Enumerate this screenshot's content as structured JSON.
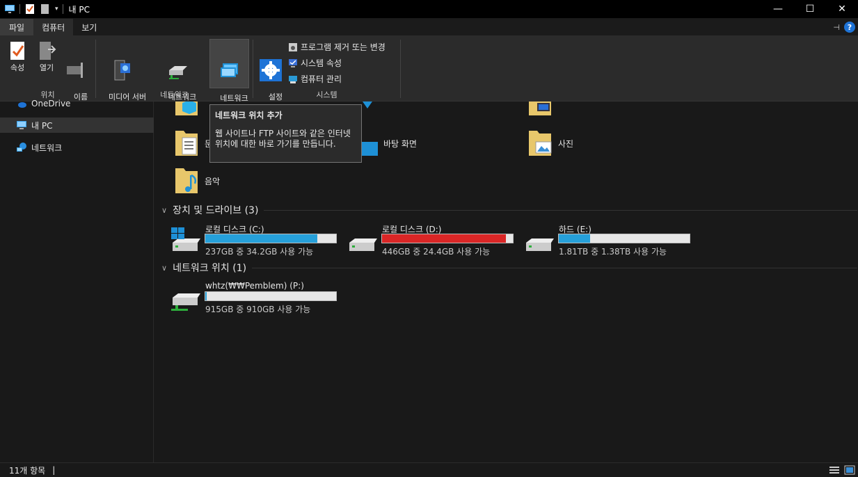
{
  "window": {
    "title": "내 PC",
    "controls": {
      "minimize": "—",
      "maximize": "☐",
      "close": "✕"
    }
  },
  "tabs": [
    {
      "label": "파일"
    },
    {
      "label": "컴퓨터"
    },
    {
      "label": "보기"
    }
  ],
  "help_glyph": "?",
  "ribbon": {
    "location_group": {
      "label": "위치",
      "properties": "속성",
      "open": "열기",
      "rename": "이름\n바꾸기"
    },
    "network_group": {
      "label": "네트워크",
      "media_server": "미디어 서버\n연결",
      "map_drive": "네트워크\n드라이브 연결",
      "add_location": "네트워크\n위치 추가"
    },
    "system_group": {
      "label": "시스템",
      "open_settings": "설정\n열기",
      "uninstall": "프로그램 제거 또는 변경",
      "system_props": "시스템 속성",
      "manage": "컴퓨터 관리"
    }
  },
  "sidebar": {
    "items": [
      {
        "label": "OneDrive",
        "icon": "onedrive-icon"
      },
      {
        "label": "내 PC",
        "icon": "pc-icon"
      },
      {
        "label": "네트워크",
        "icon": "network-icon"
      }
    ]
  },
  "folders": [
    {
      "label": "",
      "icon": "3d-objects-folder-icon"
    },
    {
      "label": "",
      "icon": "downloads-folder-icon"
    },
    {
      "label": "",
      "icon": "videos-folder-icon"
    },
    {
      "label": "문서",
      "icon": "documents-folder-icon"
    },
    {
      "label": "바탕 화면",
      "icon": "desktop-folder-icon"
    },
    {
      "label": "사진",
      "icon": "pictures-folder-icon"
    },
    {
      "label": "음악",
      "icon": "music-folder-icon"
    }
  ],
  "sections": {
    "devices": "장치 및 드라이브 (3)",
    "network": "네트워크 위치 (1)"
  },
  "drives": [
    {
      "name": "로컬 디스크 (C:)",
      "info": "237GB 중 34.2GB 사용 가능",
      "used_fraction": 0.856,
      "color": "#26a0da"
    },
    {
      "name": "로컬 디스크 (D:)",
      "info": "446GB 중 24.4GB 사용 가능",
      "used_fraction": 0.945,
      "color": "#da2626"
    },
    {
      "name": "하드 (E:)",
      "info": "1.81TB 중 1.38TB 사용 가능",
      "used_fraction": 0.238,
      "color": "#26a0da"
    }
  ],
  "network_locations": [
    {
      "name": "whtz(₩₩Pemblem) (P:)",
      "info": "915GB 중 910GB 사용 가능",
      "used_fraction": 0.005,
      "color": "#26a0da"
    }
  ],
  "tooltip": {
    "title": "네트워크 위치 추가",
    "body": "웹 사이트나 FTP 사이트와 같은 인터넷 위치에 대한 바로 가기를 만듭니다."
  },
  "status": {
    "count": "11개 항목",
    "cursor": "|"
  }
}
